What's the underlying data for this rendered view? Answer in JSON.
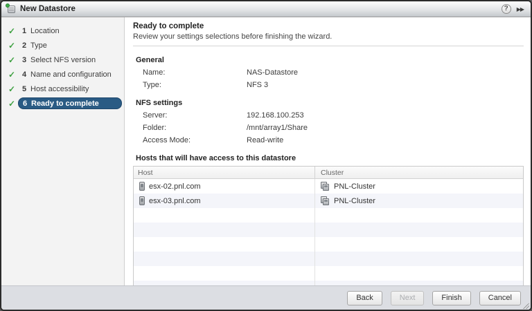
{
  "window": {
    "title": "New Datastore",
    "help_label": "?",
    "collapse_label": "▶▶"
  },
  "sidebar": {
    "steps": [
      {
        "num": "1",
        "label": "Location"
      },
      {
        "num": "2",
        "label": "Type"
      },
      {
        "num": "3",
        "label": "Select NFS version"
      },
      {
        "num": "4",
        "label": "Name and configuration"
      },
      {
        "num": "5",
        "label": "Host accessibility"
      },
      {
        "num": "6",
        "label": "Ready to complete"
      }
    ],
    "check_glyph": "✓"
  },
  "main": {
    "title": "Ready to complete",
    "subtitle": "Review your settings selections before finishing the wizard.",
    "sections": [
      {
        "heading": "General",
        "rows": [
          {
            "label": "Name:",
            "value": "NAS-Datastore"
          },
          {
            "label": "Type:",
            "value": "NFS 3"
          }
        ]
      },
      {
        "heading": "NFS settings",
        "rows": [
          {
            "label": "Server:",
            "value": "192.168.100.253"
          },
          {
            "label": "Folder:",
            "value": "/mnt/array1/Share"
          },
          {
            "label": "Access Mode:",
            "value": "Read-write"
          }
        ]
      }
    ],
    "table": {
      "heading": "Hosts that will have access to this datastore",
      "columns": [
        "Host",
        "Cluster"
      ],
      "rows": [
        {
          "host": "esx-02.pnl.com",
          "cluster": "PNL-Cluster"
        },
        {
          "host": "esx-03.pnl.com",
          "cluster": "PNL-Cluster"
        }
      ]
    }
  },
  "footer": {
    "buttons": [
      {
        "label": "Back",
        "enabled": true
      },
      {
        "label": "Next",
        "enabled": false
      },
      {
        "label": "Finish",
        "enabled": true
      },
      {
        "label": "Cancel",
        "enabled": true
      }
    ]
  },
  "colors": {
    "active_step_bg": "#2a5b84",
    "check_green": "#3fa142",
    "footer_bg": "#dcdee3",
    "row_stripe": "#f4f5fa"
  }
}
